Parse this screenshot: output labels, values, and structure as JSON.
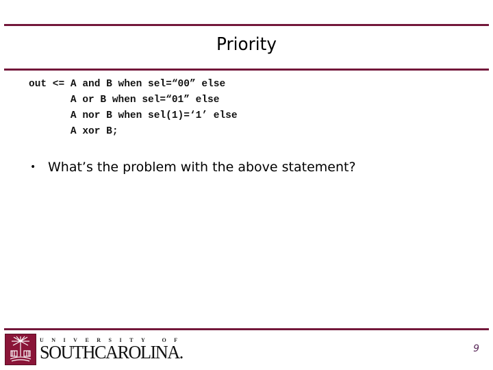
{
  "slide": {
    "title": "Priority",
    "code_lines": [
      "out <= A and B when sel=“00” else",
      "       A or B when sel=“01” else",
      "       A nor B when sel(1)=‘1’ else",
      "       A xor B;"
    ],
    "bullets": [
      "What’s the problem with the above statement?"
    ],
    "bullet_glyph": "•",
    "page_number": "9"
  },
  "footer": {
    "logo_icon": "palmetto-tree-icon",
    "wordmark_top": "UNIVERSITY OF",
    "wordmark_bottom": "SOUTHCAROLINA."
  },
  "colors": {
    "rule": "#73173a",
    "logo_bg": "#8a1538",
    "page_number": "#5a2a5a"
  }
}
